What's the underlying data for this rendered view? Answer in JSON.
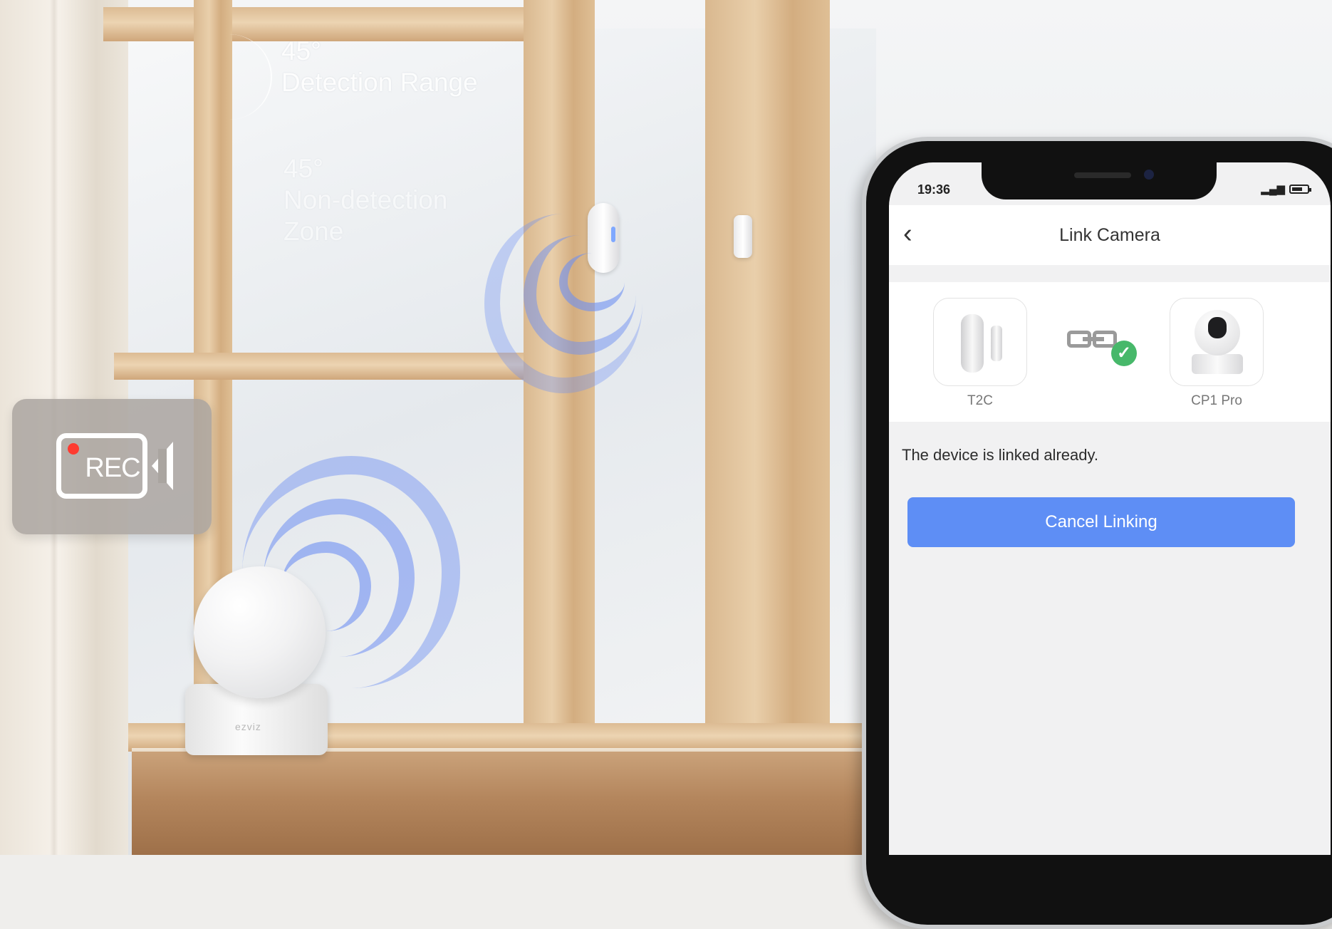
{
  "overlay": {
    "detection_angle": "45°",
    "detection_label": "Detection Range",
    "nondetection_angle": "45°",
    "nondetection_line1": "Non-detection",
    "nondetection_line2": "Zone"
  },
  "rec_badge": {
    "label": "REC",
    "icon": "video-camera-rec-icon"
  },
  "camera_logo": "ezviz",
  "phone": {
    "status": {
      "time": "19:36",
      "signal_icon": "signal-icon",
      "battery_icon": "battery-icon"
    },
    "header": {
      "back_icon": "chevron-left-icon",
      "title": "Link Camera"
    },
    "devices": [
      {
        "name": "T2C",
        "icon": "door-sensor-icon"
      },
      {
        "name": "CP1 Pro",
        "icon": "pan-tilt-camera-icon"
      }
    ],
    "link_icon": "linked-chain-check-icon",
    "message": "The device is linked already.",
    "cancel_button": "Cancel Linking"
  },
  "colors": {
    "accent": "#5e8ef5",
    "success": "#47b86a",
    "wave": "#6e8ff2"
  }
}
